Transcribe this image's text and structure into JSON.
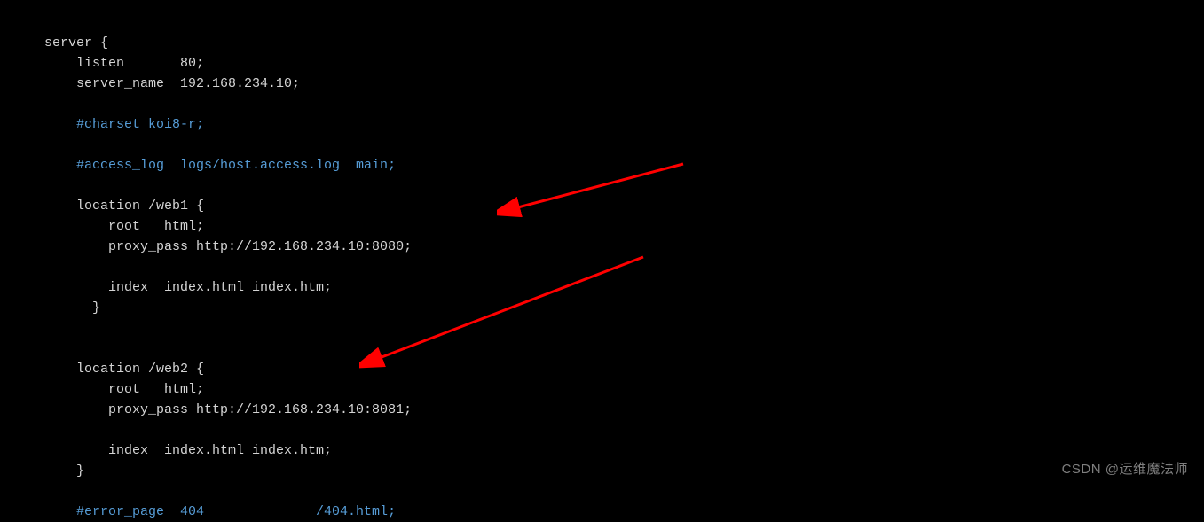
{
  "code": {
    "l01": "server {",
    "l02": "    listen       80;",
    "l03": "    server_name  192.168.234.10;",
    "l04": "",
    "l05": "    #charset koi8-r;",
    "l06": "",
    "l07": "    #access_log  logs/host.access.log  main;",
    "l08": "",
    "l09": "    location /web1 {",
    "l10": "        root   html;",
    "l11": "        proxy_pass http://192.168.234.10:8080;",
    "l12": "",
    "l13": "        index  index.html index.htm;",
    "l14": "      }",
    "l15": "",
    "l16": "",
    "l17": "    location /web2 {",
    "l18": "        root   html;",
    "l19": "        proxy_pass http://192.168.234.10:8081;",
    "l20": "",
    "l21": "        index  index.html index.htm;",
    "l22": "    }",
    "l23": "",
    "l24": "    #error_page  404              /404.html;"
  },
  "watermark": "CSDN @运维魔法师"
}
